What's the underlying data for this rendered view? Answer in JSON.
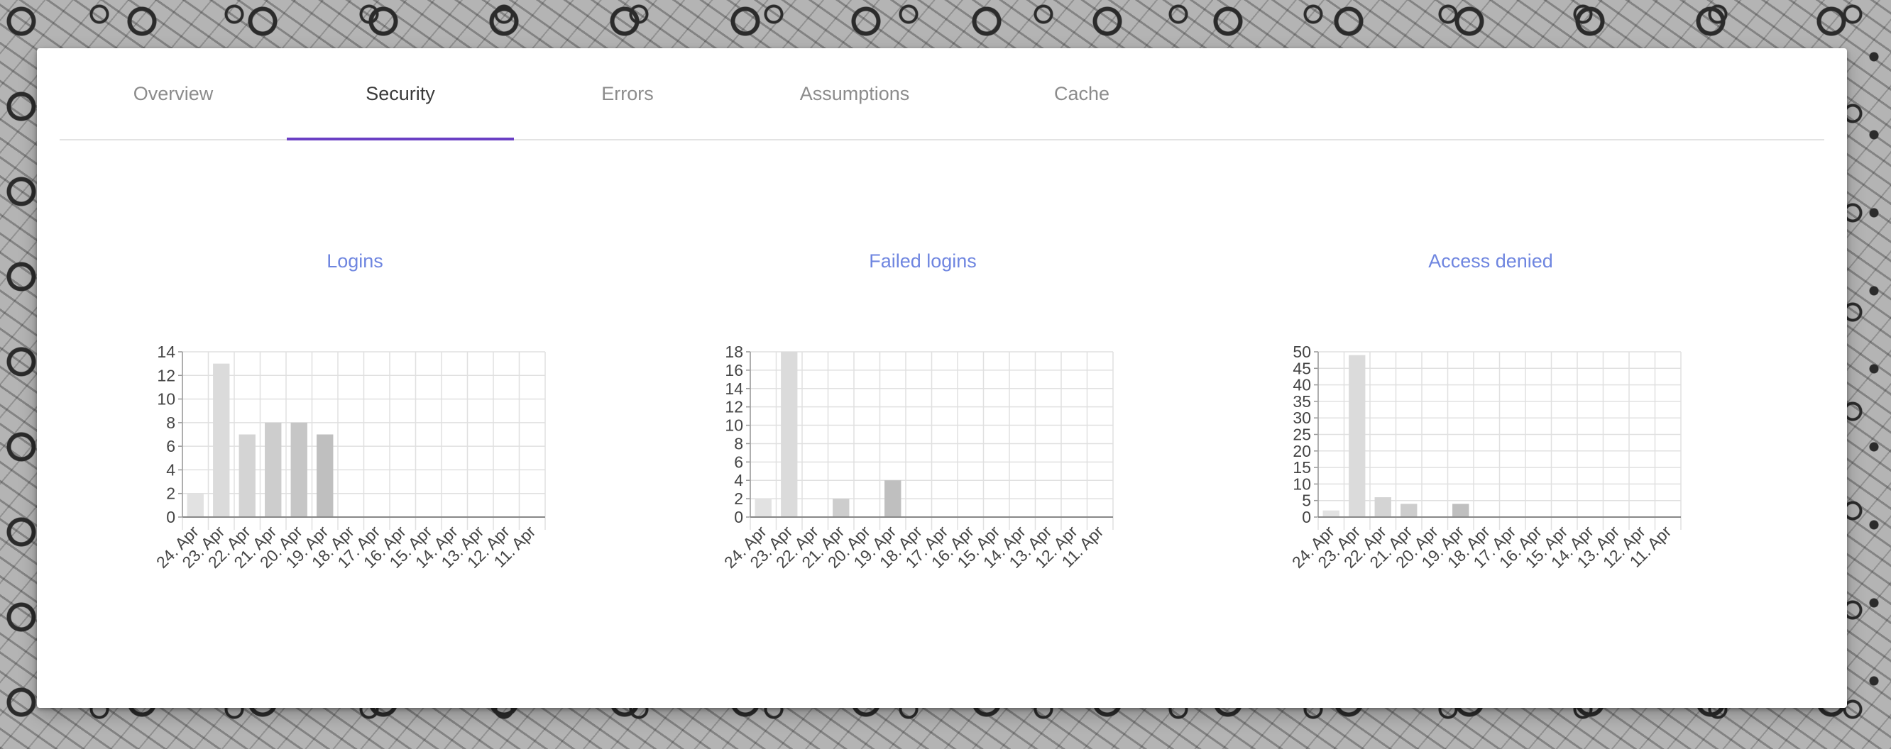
{
  "tabs": [
    {
      "label": "Overview",
      "active": false
    },
    {
      "label": "Security",
      "active": true
    },
    {
      "label": "Errors",
      "active": false
    },
    {
      "label": "Assumptions",
      "active": false
    },
    {
      "label": "Cache",
      "active": false
    }
  ],
  "colors": {
    "accent": "#6a3fc4",
    "chart_title": "#6f86e0",
    "bar_shades": [
      "#e2e2e2",
      "#dbdbdb",
      "#d4d4d4",
      "#cdcdcd",
      "#c6c6c6",
      "#bfbfbf"
    ]
  },
  "chart_data": [
    {
      "type": "bar",
      "title": "Logins",
      "categories": [
        "24. Apr",
        "23. Apr",
        "22. Apr",
        "21. Apr",
        "20. Apr",
        "19. Apr",
        "18. Apr",
        "17. Apr",
        "16. Apr",
        "15. Apr",
        "14. Apr",
        "13. Apr",
        "12. Apr",
        "11. Apr"
      ],
      "values": [
        2,
        13,
        7,
        8,
        8,
        7,
        0,
        0,
        0,
        0,
        0,
        0,
        0,
        0
      ],
      "ylim": [
        0,
        14
      ],
      "yticks": [
        0,
        2,
        4,
        6,
        8,
        10,
        12,
        14
      ],
      "grid": true
    },
    {
      "type": "bar",
      "title": "Failed logins",
      "categories": [
        "24. Apr",
        "23. Apr",
        "22. Apr",
        "21. Apr",
        "20. Apr",
        "19. Apr",
        "18. Apr",
        "17. Apr",
        "16. Apr",
        "15. Apr",
        "14. Apr",
        "13. Apr",
        "12. Apr",
        "11. Apr"
      ],
      "values": [
        2,
        18,
        0,
        2,
        0,
        4,
        0,
        0,
        0,
        0,
        0,
        0,
        0,
        0
      ],
      "ylim": [
        0,
        18
      ],
      "yticks": [
        0,
        2,
        4,
        6,
        8,
        10,
        12,
        14,
        16,
        18
      ],
      "grid": true
    },
    {
      "type": "bar",
      "title": "Access denied",
      "categories": [
        "24. Apr",
        "23. Apr",
        "22. Apr",
        "21. Apr",
        "20. Apr",
        "19. Apr",
        "18. Apr",
        "17. Apr",
        "16. Apr",
        "15. Apr",
        "14. Apr",
        "13. Apr",
        "12. Apr",
        "11. Apr"
      ],
      "values": [
        2,
        49,
        6,
        4,
        0,
        4,
        0,
        0,
        0,
        0,
        0,
        0,
        0,
        0
      ],
      "ylim": [
        0,
        50
      ],
      "yticks": [
        0,
        5,
        10,
        15,
        20,
        25,
        30,
        35,
        40,
        45,
        50
      ],
      "grid": true
    }
  ]
}
